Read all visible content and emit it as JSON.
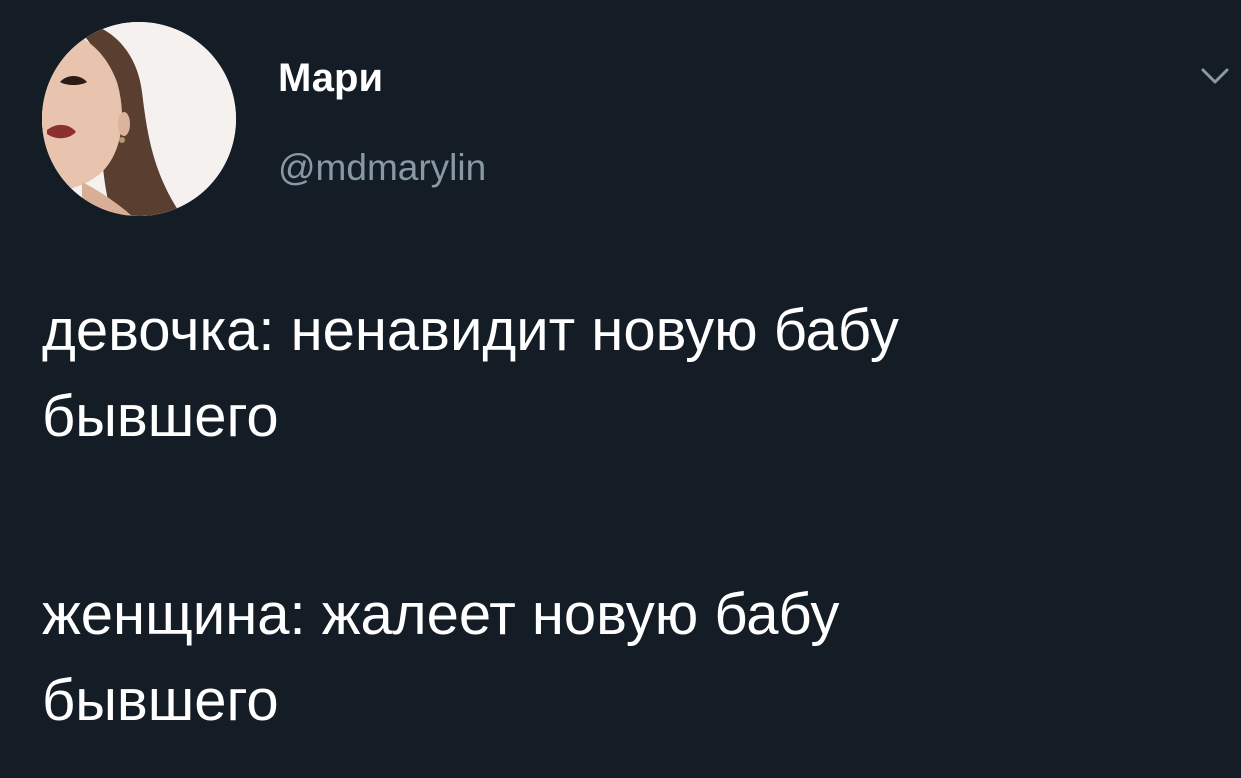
{
  "author": {
    "display_name": "Мари",
    "handle": "@mdmarylin",
    "avatar_icon": "profile-photo"
  },
  "menu": {
    "icon": "chevron-down-icon"
  },
  "tweet": {
    "paragraph_1": {
      "line_1": "девочка: ненавидит новую бабу",
      "line_2": "бывшего"
    },
    "paragraph_2": {
      "line_1": "женщина: жалеет новую бабу",
      "line_2": "бывшего"
    }
  },
  "colors": {
    "background": "#141d26",
    "text_primary": "#ffffff",
    "text_secondary": "#8899a6"
  }
}
